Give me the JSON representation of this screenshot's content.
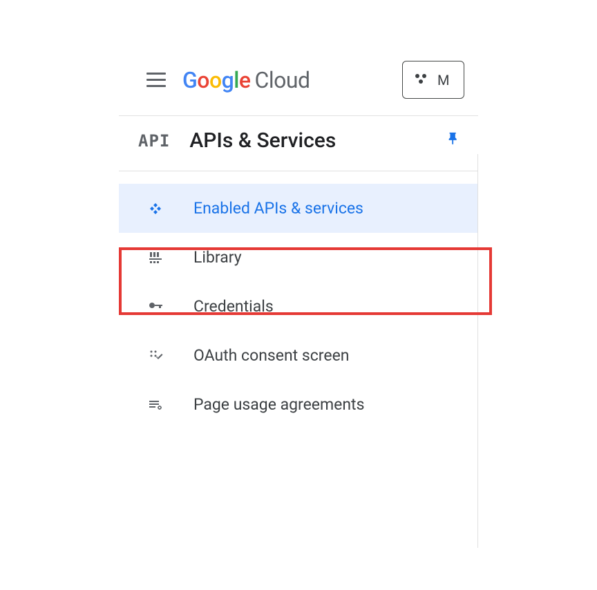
{
  "header": {
    "logo_google": "Google",
    "logo_cloud": "Cloud",
    "project_partial": "M"
  },
  "section": {
    "api_glyph": "API",
    "title": "APIs & Services"
  },
  "nav": {
    "enabled": {
      "label": "Enabled APIs & services"
    },
    "library": {
      "label": "Library"
    },
    "credentials": {
      "label": "Credentials"
    },
    "oauth": {
      "label": "OAuth consent screen"
    },
    "page_usage": {
      "label": "Page usage agreements"
    }
  }
}
